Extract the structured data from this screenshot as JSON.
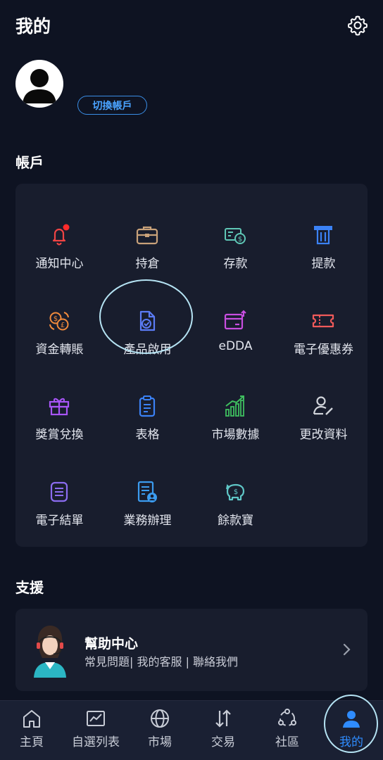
{
  "header": {
    "title": "我的",
    "settings_icon": "gear-icon"
  },
  "profile": {
    "avatar_icon": "user-avatar-icon",
    "switch_account_label": "切換帳戶"
  },
  "account": {
    "section_title": "帳戶",
    "items": [
      {
        "label": "通知中心",
        "icon": "bell-icon",
        "color": "#ef4444",
        "badge": true
      },
      {
        "label": "持倉",
        "icon": "briefcase-icon",
        "color": "#c9a27a"
      },
      {
        "label": "存款",
        "icon": "deposit-icon",
        "color": "#5fc7b6"
      },
      {
        "label": "提款",
        "icon": "withdraw-icon",
        "color": "#3b82f6"
      },
      {
        "label": "資金轉賬",
        "icon": "currency-exchange-icon",
        "color": "#f08a3c"
      },
      {
        "label": "產品啟用",
        "icon": "document-check-icon",
        "color": "#5b7cf6"
      },
      {
        "label": "eDDA",
        "icon": "edda-icon",
        "color": "#c84ee0"
      },
      {
        "label": "電子優惠券",
        "icon": "coupon-icon",
        "color": "#f05a5a"
      },
      {
        "label": "獎賞兌換",
        "icon": "gift-icon",
        "color": "#a855f7"
      },
      {
        "label": "表格",
        "icon": "clipboard-icon",
        "color": "#3b82f6"
      },
      {
        "label": "市場數據",
        "icon": "chart-growth-icon",
        "color": "#3fbf5f"
      },
      {
        "label": "更改資料",
        "icon": "user-edit-icon",
        "color": "#d1d5db"
      },
      {
        "label": "電子結單",
        "icon": "statement-icon",
        "color": "#8b6cf0"
      },
      {
        "label": "業務辦理",
        "icon": "business-form-icon",
        "color": "#3b9cf0"
      },
      {
        "label": "餘款寶",
        "icon": "piggy-bank-icon",
        "color": "#5fc7c7"
      }
    ]
  },
  "support": {
    "section_title": "支援",
    "help": {
      "title": "幫助中心",
      "subtitle": "常見問題| 我的客服 | 聯絡我們",
      "avatar_icon": "support-agent-icon"
    }
  },
  "tabbar": {
    "active": "我的",
    "active_color": "#2f8cff",
    "items": [
      {
        "label": "主頁",
        "icon": "home-icon"
      },
      {
        "label": "自選列表",
        "icon": "watchlist-chart-icon"
      },
      {
        "label": "市場",
        "icon": "globe-icon"
      },
      {
        "label": "交易",
        "icon": "trade-arrows-icon"
      },
      {
        "label": "社區",
        "icon": "community-icon"
      },
      {
        "label": "我的",
        "icon": "profile-icon"
      }
    ]
  }
}
